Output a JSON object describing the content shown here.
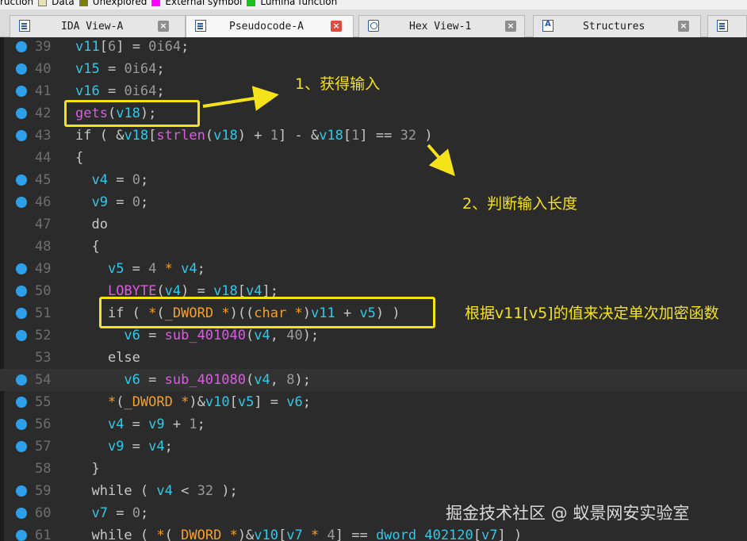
{
  "legend": [
    {
      "label": "ruction",
      "color": "#f0f0f0"
    },
    {
      "label": "Data",
      "color": "#e8e2b0"
    },
    {
      "label": "Unexplored",
      "color": "#808000"
    },
    {
      "label": "External symbol",
      "color": "#ff00ff"
    },
    {
      "label": "Lumina function",
      "color": "#20c020"
    }
  ],
  "tabs": [
    {
      "label": "IDA View-A",
      "icon": "list-icon",
      "active": false
    },
    {
      "label": "Pseudocode-A",
      "icon": "list-icon",
      "active": true
    },
    {
      "label": "Hex View-1",
      "icon": "hex-icon",
      "active": false
    },
    {
      "label": "Structures",
      "icon": "struct-icon",
      "active": false
    },
    {
      "label": "",
      "icon": "enum-icon",
      "active": false
    }
  ],
  "code_lines": [
    {
      "num": "39",
      "text": "v11[6] = 0i64;"
    },
    {
      "num": "40",
      "text": "v15 = 0i64;"
    },
    {
      "num": "41",
      "text": "v16 = 0i64;"
    },
    {
      "num": "42",
      "text": "gets(v18);"
    },
    {
      "num": "43",
      "text": "if ( &v18[strlen(v18) + 1] - &v18[1] == 32 )"
    },
    {
      "num": "44",
      "text": "{"
    },
    {
      "num": "45",
      "text": "  v4 = 0;"
    },
    {
      "num": "46",
      "text": "  v9 = 0;"
    },
    {
      "num": "47",
      "text": "  do"
    },
    {
      "num": "48",
      "text": "  {"
    },
    {
      "num": "49",
      "text": "    v5 = 4 * v4;"
    },
    {
      "num": "50",
      "text": "    LOBYTE(v4) = v18[v4];"
    },
    {
      "num": "51",
      "text": "    if ( *(_DWORD *)((char *)v11 + v5) )"
    },
    {
      "num": "52",
      "text": "      v6 = sub_401040(v4, 40);"
    },
    {
      "num": "53",
      "text": "    else"
    },
    {
      "num": "54",
      "text": "      v6 = sub_401080(v4, 8);"
    },
    {
      "num": "55",
      "text": "    *(_DWORD *)&v10[v5] = v6;"
    },
    {
      "num": "56",
      "text": "    v4 = v9 + 1;"
    },
    {
      "num": "57",
      "text": "    v9 = v4;"
    },
    {
      "num": "58",
      "text": "  }"
    },
    {
      "num": "59",
      "text": "  while ( v4 < 32 );"
    },
    {
      "num": "60",
      "text": "  v7 = 0;"
    },
    {
      "num": "61",
      "text": "  while ( *(_DWORD *)&v10[v7 * 4] == dword_402120[v7] )"
    }
  ],
  "breakpoint_lines": [
    "39",
    "40",
    "41",
    "42",
    "43",
    "45",
    "46",
    "49",
    "50",
    "51",
    "52",
    "54",
    "55",
    "56",
    "57",
    "59",
    "60",
    "61"
  ],
  "current_line": "54",
  "annotations": {
    "note1": "1、获得输入",
    "note2": "2、判断输入长度",
    "note3": "根据v11[v5]的值来决定单次加密函数"
  },
  "watermark": "掘金技术社区 @ 蚁景网安实验室",
  "colors": {
    "annotation": "#f4e21a",
    "variable": "#33c7e6",
    "function": "#d85ee0",
    "type": "#f0a030",
    "breakpoint": "#2ea0ea"
  }
}
